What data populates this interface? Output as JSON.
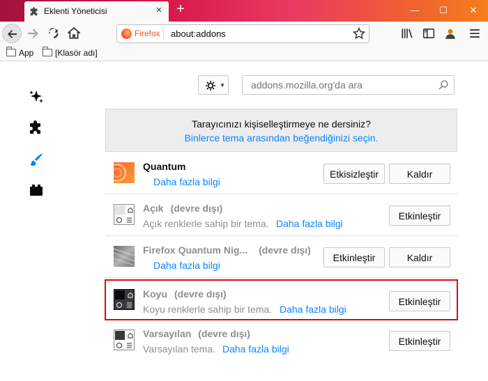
{
  "tab": {
    "title": "Eklenti Yöneticisi",
    "close": "×",
    "new_tab": "+"
  },
  "window": {
    "minimize": "—",
    "maximize": "☐",
    "close": "✕"
  },
  "urlbar": {
    "identity": "Firefox",
    "url": "about:addons"
  },
  "bookmarks": [
    {
      "label": "App"
    },
    {
      "label": "[Klasör adı]"
    }
  ],
  "search": {
    "placeholder": "addons.mozilla.org'da ara"
  },
  "banner": {
    "line1": "Tarayıcınızı kişiselleştirmeye ne dersiniz?",
    "link": "Binlerce tema arasından beğendiğinizi seçin."
  },
  "themes": [
    {
      "name": "Quantum",
      "status": "",
      "desc": "",
      "more": "Daha fazla bilgi",
      "buttons": [
        "Etkisizleştir",
        "Kaldır"
      ]
    },
    {
      "name": "Açık",
      "status": "(devre dışı)",
      "desc": "Açık renklerle sahip bir tema.",
      "more": "Daha fazla bilgi",
      "buttons": [
        "Etkinleştir"
      ]
    },
    {
      "name": "Firefox Quantum Nig...",
      "status": "(devre dışı)",
      "desc": "",
      "more": "Daha fazla bilgi",
      "buttons": [
        "Etkinleştir",
        "Kaldır"
      ]
    },
    {
      "name": "Koyu",
      "status": "(devre dışı)",
      "desc": "Koyu renklerle sahip bir tema.",
      "more": "Daha fazla bilgi",
      "buttons": [
        "Etkinleştir"
      ]
    },
    {
      "name": "Varsayılan",
      "status": "(devre dışı)",
      "desc": "Varsayılan tema.",
      "more": "Daha fazla bilgi",
      "buttons": [
        "Etkinleştir"
      ]
    }
  ],
  "colors": {
    "accent": "#0a84ff",
    "highlight": "#e2070a"
  }
}
